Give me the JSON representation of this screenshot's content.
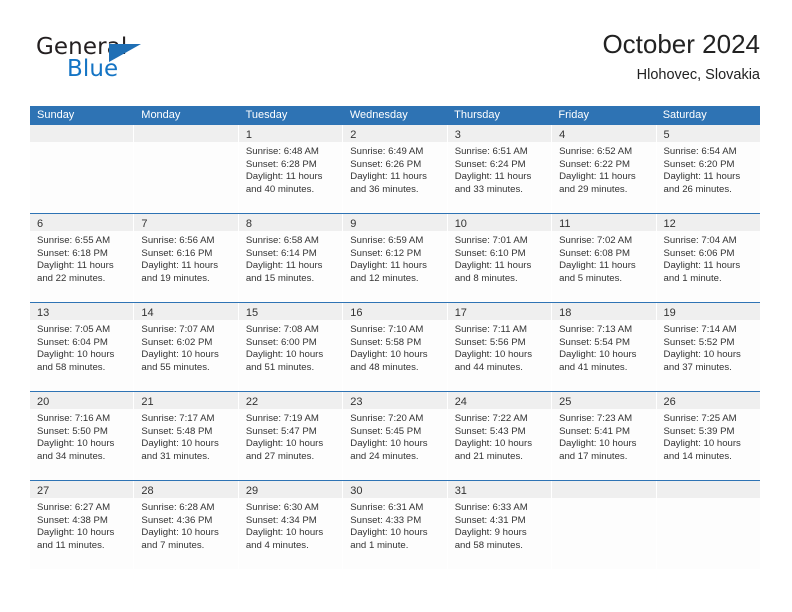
{
  "brand": {
    "name_part1": "General",
    "name_part2": "Blue",
    "flag_icon": "brand-flag-icon"
  },
  "header": {
    "title": "October 2024",
    "subtitle": "Hlohovec, Slovakia"
  },
  "colors": {
    "header_blue": "#2e73b4",
    "day_bar_grey": "#efefef",
    "brand_blue": "#1474c4",
    "text": "#333333"
  },
  "weekday_headers": [
    "Sunday",
    "Monday",
    "Tuesday",
    "Wednesday",
    "Thursday",
    "Friday",
    "Saturday"
  ],
  "weeks": [
    [
      {
        "day": "",
        "sunrise": "",
        "sunset": "",
        "daylight_line1": "",
        "daylight_line2": "",
        "empty": true
      },
      {
        "day": "",
        "sunrise": "",
        "sunset": "",
        "daylight_line1": "",
        "daylight_line2": "",
        "empty": true
      },
      {
        "day": "1",
        "sunrise": "Sunrise: 6:48 AM",
        "sunset": "Sunset: 6:28 PM",
        "daylight_line1": "Daylight: 11 hours",
        "daylight_line2": "and 40 minutes."
      },
      {
        "day": "2",
        "sunrise": "Sunrise: 6:49 AM",
        "sunset": "Sunset: 6:26 PM",
        "daylight_line1": "Daylight: 11 hours",
        "daylight_line2": "and 36 minutes."
      },
      {
        "day": "3",
        "sunrise": "Sunrise: 6:51 AM",
        "sunset": "Sunset: 6:24 PM",
        "daylight_line1": "Daylight: 11 hours",
        "daylight_line2": "and 33 minutes."
      },
      {
        "day": "4",
        "sunrise": "Sunrise: 6:52 AM",
        "sunset": "Sunset: 6:22 PM",
        "daylight_line1": "Daylight: 11 hours",
        "daylight_line2": "and 29 minutes."
      },
      {
        "day": "5",
        "sunrise": "Sunrise: 6:54 AM",
        "sunset": "Sunset: 6:20 PM",
        "daylight_line1": "Daylight: 11 hours",
        "daylight_line2": "and 26 minutes."
      }
    ],
    [
      {
        "day": "6",
        "sunrise": "Sunrise: 6:55 AM",
        "sunset": "Sunset: 6:18 PM",
        "daylight_line1": "Daylight: 11 hours",
        "daylight_line2": "and 22 minutes."
      },
      {
        "day": "7",
        "sunrise": "Sunrise: 6:56 AM",
        "sunset": "Sunset: 6:16 PM",
        "daylight_line1": "Daylight: 11 hours",
        "daylight_line2": "and 19 minutes."
      },
      {
        "day": "8",
        "sunrise": "Sunrise: 6:58 AM",
        "sunset": "Sunset: 6:14 PM",
        "daylight_line1": "Daylight: 11 hours",
        "daylight_line2": "and 15 minutes."
      },
      {
        "day": "9",
        "sunrise": "Sunrise: 6:59 AM",
        "sunset": "Sunset: 6:12 PM",
        "daylight_line1": "Daylight: 11 hours",
        "daylight_line2": "and 12 minutes."
      },
      {
        "day": "10",
        "sunrise": "Sunrise: 7:01 AM",
        "sunset": "Sunset: 6:10 PM",
        "daylight_line1": "Daylight: 11 hours",
        "daylight_line2": "and 8 minutes."
      },
      {
        "day": "11",
        "sunrise": "Sunrise: 7:02 AM",
        "sunset": "Sunset: 6:08 PM",
        "daylight_line1": "Daylight: 11 hours",
        "daylight_line2": "and 5 minutes."
      },
      {
        "day": "12",
        "sunrise": "Sunrise: 7:04 AM",
        "sunset": "Sunset: 6:06 PM",
        "daylight_line1": "Daylight: 11 hours",
        "daylight_line2": "and 1 minute."
      }
    ],
    [
      {
        "day": "13",
        "sunrise": "Sunrise: 7:05 AM",
        "sunset": "Sunset: 6:04 PM",
        "daylight_line1": "Daylight: 10 hours",
        "daylight_line2": "and 58 minutes."
      },
      {
        "day": "14",
        "sunrise": "Sunrise: 7:07 AM",
        "sunset": "Sunset: 6:02 PM",
        "daylight_line1": "Daylight: 10 hours",
        "daylight_line2": "and 55 minutes."
      },
      {
        "day": "15",
        "sunrise": "Sunrise: 7:08 AM",
        "sunset": "Sunset: 6:00 PM",
        "daylight_line1": "Daylight: 10 hours",
        "daylight_line2": "and 51 minutes."
      },
      {
        "day": "16",
        "sunrise": "Sunrise: 7:10 AM",
        "sunset": "Sunset: 5:58 PM",
        "daylight_line1": "Daylight: 10 hours",
        "daylight_line2": "and 48 minutes."
      },
      {
        "day": "17",
        "sunrise": "Sunrise: 7:11 AM",
        "sunset": "Sunset: 5:56 PM",
        "daylight_line1": "Daylight: 10 hours",
        "daylight_line2": "and 44 minutes."
      },
      {
        "day": "18",
        "sunrise": "Sunrise: 7:13 AM",
        "sunset": "Sunset: 5:54 PM",
        "daylight_line1": "Daylight: 10 hours",
        "daylight_line2": "and 41 minutes."
      },
      {
        "day": "19",
        "sunrise": "Sunrise: 7:14 AM",
        "sunset": "Sunset: 5:52 PM",
        "daylight_line1": "Daylight: 10 hours",
        "daylight_line2": "and 37 minutes."
      }
    ],
    [
      {
        "day": "20",
        "sunrise": "Sunrise: 7:16 AM",
        "sunset": "Sunset: 5:50 PM",
        "daylight_line1": "Daylight: 10 hours",
        "daylight_line2": "and 34 minutes."
      },
      {
        "day": "21",
        "sunrise": "Sunrise: 7:17 AM",
        "sunset": "Sunset: 5:48 PM",
        "daylight_line1": "Daylight: 10 hours",
        "daylight_line2": "and 31 minutes."
      },
      {
        "day": "22",
        "sunrise": "Sunrise: 7:19 AM",
        "sunset": "Sunset: 5:47 PM",
        "daylight_line1": "Daylight: 10 hours",
        "daylight_line2": "and 27 minutes."
      },
      {
        "day": "23",
        "sunrise": "Sunrise: 7:20 AM",
        "sunset": "Sunset: 5:45 PM",
        "daylight_line1": "Daylight: 10 hours",
        "daylight_line2": "and 24 minutes."
      },
      {
        "day": "24",
        "sunrise": "Sunrise: 7:22 AM",
        "sunset": "Sunset: 5:43 PM",
        "daylight_line1": "Daylight: 10 hours",
        "daylight_line2": "and 21 minutes."
      },
      {
        "day": "25",
        "sunrise": "Sunrise: 7:23 AM",
        "sunset": "Sunset: 5:41 PM",
        "daylight_line1": "Daylight: 10 hours",
        "daylight_line2": "and 17 minutes."
      },
      {
        "day": "26",
        "sunrise": "Sunrise: 7:25 AM",
        "sunset": "Sunset: 5:39 PM",
        "daylight_line1": "Daylight: 10 hours",
        "daylight_line2": "and 14 minutes."
      }
    ],
    [
      {
        "day": "27",
        "sunrise": "Sunrise: 6:27 AM",
        "sunset": "Sunset: 4:38 PM",
        "daylight_line1": "Daylight: 10 hours",
        "daylight_line2": "and 11 minutes."
      },
      {
        "day": "28",
        "sunrise": "Sunrise: 6:28 AM",
        "sunset": "Sunset: 4:36 PM",
        "daylight_line1": "Daylight: 10 hours",
        "daylight_line2": "and 7 minutes."
      },
      {
        "day": "29",
        "sunrise": "Sunrise: 6:30 AM",
        "sunset": "Sunset: 4:34 PM",
        "daylight_line1": "Daylight: 10 hours",
        "daylight_line2": "and 4 minutes."
      },
      {
        "day": "30",
        "sunrise": "Sunrise: 6:31 AM",
        "sunset": "Sunset: 4:33 PM",
        "daylight_line1": "Daylight: 10 hours",
        "daylight_line2": "and 1 minute."
      },
      {
        "day": "31",
        "sunrise": "Sunrise: 6:33 AM",
        "sunset": "Sunset: 4:31 PM",
        "daylight_line1": "Daylight: 9 hours",
        "daylight_line2": "and 58 minutes."
      },
      {
        "day": "",
        "sunrise": "",
        "sunset": "",
        "daylight_line1": "",
        "daylight_line2": "",
        "empty": true
      },
      {
        "day": "",
        "sunrise": "",
        "sunset": "",
        "daylight_line1": "",
        "daylight_line2": "",
        "empty": true
      }
    ]
  ]
}
